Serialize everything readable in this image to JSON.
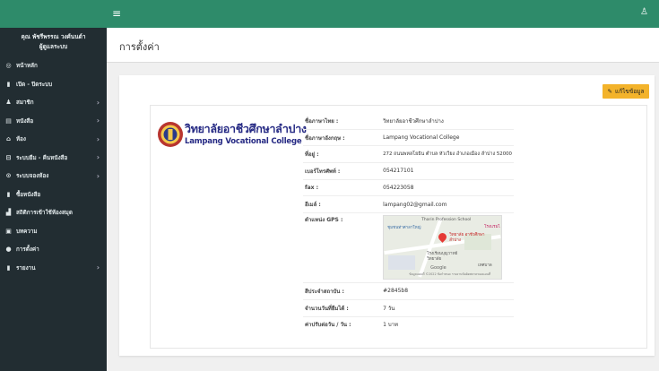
{
  "topbar": {
    "menu_icon": "hamburger-icon",
    "user_icon": "user-icon"
  },
  "sidebar": {
    "user_name": "คุณ พัชรีพรรณ วงศ์นนต์า",
    "user_role": "ผู้ดูแลระบบ",
    "items": [
      {
        "icon": "dashboard-icon",
        "glyph": "◎",
        "label": "หน้าหลัก",
        "chevron": false
      },
      {
        "icon": "book-icon",
        "glyph": "▮",
        "label": "เปิด - ปิดระบบ",
        "chevron": false
      },
      {
        "icon": "member-icon",
        "glyph": "♟",
        "label": "สมาชิก",
        "chevron": true
      },
      {
        "icon": "book-icon",
        "glyph": "▤",
        "label": "หนังสือ",
        "chevron": true
      },
      {
        "icon": "room-icon",
        "glyph": "⌂",
        "label": "ห้อง",
        "chevron": true
      },
      {
        "icon": "borrow-icon",
        "glyph": "⊟",
        "label": "ระบบยืม - คืนหนังสือ",
        "chevron": true
      },
      {
        "icon": "booking-icon",
        "glyph": "⊙",
        "label": "ระบบจองห้อง",
        "chevron": true
      },
      {
        "icon": "bookmark-icon",
        "glyph": "▮",
        "label": "ซื้อหนังสือ",
        "chevron": false
      },
      {
        "icon": "stats-icon",
        "glyph": "▟",
        "label": "สถิติการเข้าใช้ห้องสมุด",
        "chevron": false
      },
      {
        "icon": "article-icon",
        "glyph": "▣",
        "label": "บทความ",
        "chevron": false
      },
      {
        "icon": "settings-icon",
        "glyph": "●",
        "label": "การตั้งค่า",
        "chevron": false
      },
      {
        "icon": "report-icon",
        "glyph": "▮",
        "label": "รายงาน",
        "chevron": true
      }
    ]
  },
  "header": {
    "title": "การตั้งค่า"
  },
  "edit_button": {
    "label": "แก้ไขข้อมูล",
    "icon": "edit-icon"
  },
  "college": {
    "name_th": "วิทยาลัยอาชีวศึกษาลำปาง",
    "name_en": "Lampang Vocational College"
  },
  "info": {
    "thai_name": {
      "label": "ชื่อภาษาไทย :",
      "value": "วิทยาลัยอาชีวศึกษาลำปาง"
    },
    "eng_name": {
      "label": "ชื่อภาษาอังกฤษ :",
      "value": "Lampang Vocational College"
    },
    "address": {
      "label": "ที่อยู่ :",
      "value": "272 ถนนพหลโยธิน ตำบล หัวเวียง อำเภอเมือง ลำปาง 52000"
    },
    "phone": {
      "label": "เบอร์โทรศัพท์ :",
      "value": "054217101"
    },
    "fax": {
      "label": "fax :",
      "value": "054223058"
    },
    "email": {
      "label": "อีเมล์ :",
      "value": "lampang02@gmail.com"
    },
    "gps": {
      "label": "ตำแหน่ง GPS :"
    },
    "library_code": {
      "label": "สีประจำสถาบัน :",
      "value": "#2845b8"
    },
    "borrow_days": {
      "label": "จำนวนวันที่ยืมได้ :",
      "value": "7 วัน"
    },
    "fine": {
      "label": "ค่าปรับต่อวัน / วัน :",
      "value": "1 บาท"
    }
  },
  "map": {
    "top_label": "Tharin Profession School",
    "left_label": "ชุมชนท่าศาลาใหญ่",
    "right_label": "โรงแรมไ",
    "pin_label": "วิทยาลัย อาชีวศึกษาลำปาง",
    "school_label": "โรงเรียนบุญวาทย์ วิทยาลัย",
    "district_label": "เทศบาล",
    "google": "Google",
    "footer": "ข้อมูลแผนที่ ©2022  ข้อกำหนด  รายงานข้อผิดพลาดของแผนที่"
  }
}
